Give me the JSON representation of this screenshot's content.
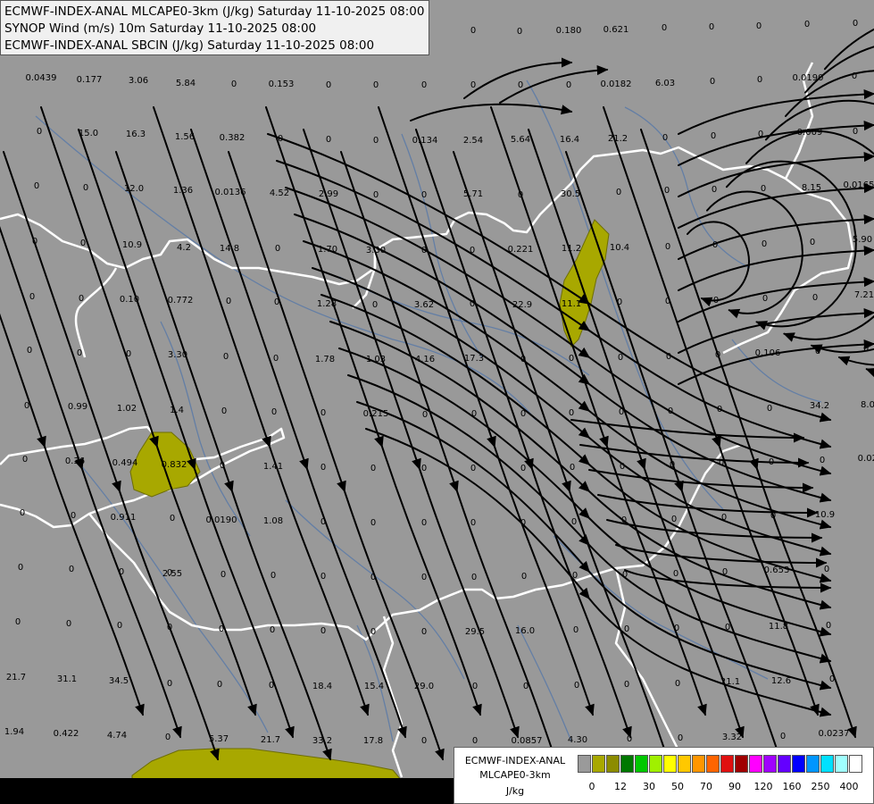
{
  "header": {
    "line1": "ECMWF-INDEX-ANAL MLCAPE0-3km (J/kg) Saturday 11-10-2025 08:00",
    "line2": "SYNOP Wind (m/s) 10m Saturday 11-10-2025 08:00",
    "line3": "ECMWF-INDEX-ANAL SBCIN (J/kg) Saturday 11-10-2025 08:00"
  },
  "legend": {
    "title1": "ECMWF-INDEX-ANAL",
    "title2": "MLCAPE0-3km",
    "unit": "J/kg",
    "ticks": [
      "0",
      "12",
      "30",
      "50",
      "70",
      "90",
      "120",
      "160",
      "250",
      "400"
    ],
    "colors": [
      "#9a9a9a",
      "#a8a800",
      "#8c8c00",
      "#007800",
      "#00c800",
      "#a0f000",
      "#ffff00",
      "#ffc800",
      "#ff9600",
      "#ff6400",
      "#e01010",
      "#a00000",
      "#ff00ff",
      "#a000ff",
      "#6400ff",
      "#0000ff",
      "#0096ff",
      "#00e0ff",
      "#a0ffff",
      "#ffffff"
    ]
  },
  "colors": {
    "background": "#999999",
    "streamline": "#000000",
    "border": "#ffffff",
    "river": "#5a7aa8",
    "cape_area": "#a8a800"
  },
  "values": [
    [
      "0.0439",
      46,
      90
    ],
    [
      "0.177",
      100,
      92
    ],
    [
      "3.06",
      155,
      93
    ],
    [
      "5.84",
      208,
      96
    ],
    [
      "0",
      262,
      97
    ],
    [
      "0.153",
      315,
      97
    ],
    [
      "0",
      368,
      98
    ],
    [
      "0",
      421,
      98
    ],
    [
      "0",
      475,
      98
    ],
    [
      "0",
      530,
      98
    ],
    [
      "0",
      583,
      98
    ],
    [
      "0",
      637,
      98
    ],
    [
      "0.0182",
      690,
      97
    ],
    [
      "6.03",
      745,
      96
    ],
    [
      "0",
      798,
      94
    ],
    [
      "0",
      851,
      92
    ],
    [
      "0.0190",
      905,
      90
    ],
    [
      "0",
      957,
      88
    ],
    [
      "0",
      44,
      150
    ],
    [
      "15.0",
      99,
      152
    ],
    [
      "16.3",
      152,
      153
    ],
    [
      "1.56",
      207,
      156
    ],
    [
      "0.382",
      260,
      157
    ],
    [
      "0",
      314,
      158
    ],
    [
      "0",
      368,
      159
    ],
    [
      "0",
      421,
      160
    ],
    [
      "0.134",
      476,
      160
    ],
    [
      "2.54",
      530,
      160
    ],
    [
      "5.64",
      583,
      159
    ],
    [
      "16.4",
      638,
      159
    ],
    [
      "21.2",
      692,
      158
    ],
    [
      "0",
      745,
      157
    ],
    [
      "0",
      799,
      155
    ],
    [
      "0",
      852,
      153
    ],
    [
      "0.009",
      907,
      151
    ],
    [
      "0",
      958,
      150
    ],
    [
      "0",
      41,
      211
    ],
    [
      "0",
      96,
      213
    ],
    [
      "12.0",
      150,
      214
    ],
    [
      "1.36",
      205,
      216
    ],
    [
      "0.0136",
      258,
      218
    ],
    [
      "4.52",
      313,
      219
    ],
    [
      "2.99",
      368,
      220
    ],
    [
      "0",
      421,
      221
    ],
    [
      "0",
      475,
      221
    ],
    [
      "5.71",
      530,
      220
    ],
    [
      "0",
      583,
      221
    ],
    [
      "30.5",
      639,
      220
    ],
    [
      "0",
      693,
      218
    ],
    [
      "0",
      747,
      216
    ],
    [
      "0",
      800,
      215
    ],
    [
      "0",
      855,
      214
    ],
    [
      "8.15",
      909,
      213
    ],
    [
      "0.0165",
      962,
      210
    ],
    [
      "0",
      39,
      273
    ],
    [
      "0",
      93,
      275
    ],
    [
      "10.9",
      148,
      277
    ],
    [
      "4.2",
      206,
      280
    ],
    [
      "14.8",
      257,
      281
    ],
    [
      "0",
      311,
      281
    ],
    [
      "1.70",
      367,
      282
    ],
    [
      "3.30",
      421,
      283
    ],
    [
      "0",
      475,
      283
    ],
    [
      "0",
      529,
      283
    ],
    [
      "0.221",
      583,
      282
    ],
    [
      "11.2",
      640,
      281
    ],
    [
      "10.4",
      694,
      280
    ],
    [
      "0",
      748,
      279
    ],
    [
      "0",
      801,
      277
    ],
    [
      "0",
      856,
      276
    ],
    [
      "0",
      910,
      274
    ],
    [
      "5.90",
      966,
      271
    ],
    [
      "0",
      36,
      335
    ],
    [
      "0",
      91,
      337
    ],
    [
      "0.10",
      145,
      338
    ],
    [
      "0.772",
      202,
      339
    ],
    [
      "0",
      256,
      340
    ],
    [
      "0",
      310,
      341
    ],
    [
      "1.28",
      366,
      343
    ],
    [
      "0",
      420,
      344
    ],
    [
      "3.62",
      475,
      344
    ],
    [
      "0",
      529,
      343
    ],
    [
      "22.9",
      585,
      344
    ],
    [
      "11.1",
      640,
      343
    ],
    [
      "0",
      694,
      341
    ],
    [
      "0",
      748,
      340
    ],
    [
      "0",
      802,
      339
    ],
    [
      "0",
      857,
      337
    ],
    [
      "0",
      913,
      336
    ],
    [
      "7.21",
      968,
      333
    ],
    [
      "0",
      33,
      395
    ],
    [
      "0",
      89,
      398
    ],
    [
      "0",
      144,
      399
    ],
    [
      "3.30",
      199,
      400
    ],
    [
      "0",
      253,
      402
    ],
    [
      "0",
      309,
      404
    ],
    [
      "1.78",
      364,
      405
    ],
    [
      "1.03",
      421,
      405
    ],
    [
      "4.16",
      476,
      405
    ],
    [
      "17.3",
      531,
      404
    ],
    [
      "0",
      586,
      405
    ],
    [
      "0",
      640,
      404
    ],
    [
      "0",
      695,
      403
    ],
    [
      "0",
      749,
      402
    ],
    [
      "0",
      804,
      400
    ],
    [
      "0.106",
      860,
      398
    ],
    [
      "0",
      916,
      396
    ],
    [
      "0",
      970,
      393
    ],
    [
      "0",
      30,
      457
    ],
    [
      "0.99",
      87,
      458
    ],
    [
      "1.02",
      142,
      460
    ],
    [
      "1.4",
      198,
      462
    ],
    [
      "0",
      251,
      463
    ],
    [
      "0",
      307,
      464
    ],
    [
      "0",
      362,
      465
    ],
    [
      "0.215",
      421,
      466
    ],
    [
      "0",
      476,
      467
    ],
    [
      "0",
      531,
      466
    ],
    [
      "0",
      586,
      466
    ],
    [
      "0",
      640,
      465
    ],
    [
      "0",
      696,
      464
    ],
    [
      "0",
      751,
      463
    ],
    [
      "0",
      806,
      461
    ],
    [
      "0",
      862,
      460
    ],
    [
      "34.2",
      918,
      457
    ],
    [
      "8.0",
      972,
      456
    ],
    [
      "0",
      28,
      517
    ],
    [
      "0.36",
      84,
      519
    ],
    [
      "0.494",
      140,
      521
    ],
    [
      "0.832",
      195,
      523
    ],
    [
      "0",
      249,
      524
    ],
    [
      "1.41",
      306,
      525
    ],
    [
      "0",
      362,
      526
    ],
    [
      "0",
      418,
      527
    ],
    [
      "0",
      475,
      527
    ],
    [
      "0",
      530,
      527
    ],
    [
      "0",
      586,
      527
    ],
    [
      "0",
      641,
      526
    ],
    [
      "0",
      697,
      525
    ],
    [
      "0",
      753,
      523
    ],
    [
      "0",
      808,
      521
    ],
    [
      "0",
      864,
      520
    ],
    [
      "0",
      921,
      518
    ],
    [
      "0.023",
      975,
      516
    ],
    [
      "0",
      25,
      577
    ],
    [
      "0",
      82,
      580
    ],
    [
      "0.911",
      138,
      582
    ],
    [
      "0",
      193,
      583
    ],
    [
      "0.0190",
      248,
      585
    ],
    [
      "1.08",
      306,
      586
    ],
    [
      "0",
      362,
      587
    ],
    [
      "0",
      418,
      588
    ],
    [
      "0",
      475,
      588
    ],
    [
      "0",
      530,
      588
    ],
    [
      "0",
      586,
      588
    ],
    [
      "0",
      643,
      587
    ],
    [
      "0",
      699,
      585
    ],
    [
      "0",
      755,
      584
    ],
    [
      "0",
      811,
      582
    ],
    [
      "0",
      866,
      580
    ],
    [
      "10.9",
      924,
      579
    ],
    [
      "0",
      23,
      638
    ],
    [
      "0",
      80,
      640
    ],
    [
      "0",
      136,
      643
    ],
    [
      "0",
      190,
      644
    ],
    [
      "2.55",
      193,
      645
    ],
    [
      "0",
      250,
      646
    ],
    [
      "0",
      306,
      647
    ],
    [
      "0",
      362,
      648
    ],
    [
      "0",
      418,
      649
    ],
    [
      "0",
      475,
      649
    ],
    [
      "0",
      531,
      649
    ],
    [
      "0",
      587,
      648
    ],
    [
      "0",
      644,
      647
    ],
    [
      "0",
      700,
      646
    ],
    [
      "0",
      757,
      645
    ],
    [
      "0",
      812,
      643
    ],
    [
      "0.653",
      870,
      641
    ],
    [
      "0",
      926,
      640
    ],
    [
      "0",
      20,
      699
    ],
    [
      "0",
      77,
      701
    ],
    [
      "0",
      134,
      703
    ],
    [
      "0",
      190,
      705
    ],
    [
      "0",
      248,
      707
    ],
    [
      "0",
      305,
      708
    ],
    [
      "0",
      362,
      709
    ],
    [
      "0",
      418,
      710
    ],
    [
      "0",
      475,
      710
    ],
    [
      "29.5",
      532,
      710
    ],
    [
      "16.0",
      588,
      709
    ],
    [
      "0",
      645,
      708
    ],
    [
      "0",
      702,
      707
    ],
    [
      "0",
      758,
      706
    ],
    [
      "0",
      815,
      705
    ],
    [
      "11.8",
      872,
      704
    ],
    [
      "0",
      928,
      703
    ],
    [
      "21.7",
      18,
      761
    ],
    [
      "31.1",
      75,
      763
    ],
    [
      "34.5",
      133,
      765
    ],
    [
      "0",
      190,
      768
    ],
    [
      "0",
      246,
      769
    ],
    [
      "0",
      304,
      770
    ],
    [
      "18.4",
      361,
      771
    ],
    [
      "15.4",
      419,
      771
    ],
    [
      "29.0",
      475,
      771
    ],
    [
      "0",
      532,
      771
    ],
    [
      "0",
      589,
      771
    ],
    [
      "0",
      646,
      770
    ],
    [
      "0",
      702,
      769
    ],
    [
      "0",
      759,
      768
    ],
    [
      "21.1",
      818,
      766
    ],
    [
      "12.6",
      875,
      765
    ],
    [
      "0",
      932,
      763
    ],
    [
      "1.94",
      16,
      822
    ],
    [
      "0.422",
      74,
      824
    ],
    [
      "4.74",
      131,
      826
    ],
    [
      "0",
      188,
      828
    ],
    [
      "5.37",
      245,
      830
    ],
    [
      "21.7",
      303,
      831
    ],
    [
      "33.2",
      361,
      832
    ],
    [
      "17.8",
      418,
      832
    ],
    [
      "0",
      475,
      832
    ],
    [
      "0",
      532,
      832
    ],
    [
      "0.0857",
      590,
      832
    ],
    [
      "4.30",
      647,
      831
    ],
    [
      "0",
      705,
      830
    ],
    [
      "0",
      762,
      829
    ],
    [
      "3.32",
      820,
      828
    ],
    [
      "0",
      877,
      827
    ],
    [
      "0.0237",
      934,
      824
    ],
    [
      "0",
      368,
      37
    ],
    [
      "0",
      421,
      37
    ],
    [
      "0",
      475,
      37
    ],
    [
      "0",
      530,
      37
    ],
    [
      "0",
      582,
      38
    ],
    [
      "0.180",
      637,
      37
    ],
    [
      "0.621",
      690,
      36
    ],
    [
      "0",
      744,
      34
    ],
    [
      "0",
      797,
      33
    ],
    [
      "0",
      850,
      32
    ],
    [
      "0",
      904,
      30
    ],
    [
      "0",
      958,
      29
    ]
  ]
}
